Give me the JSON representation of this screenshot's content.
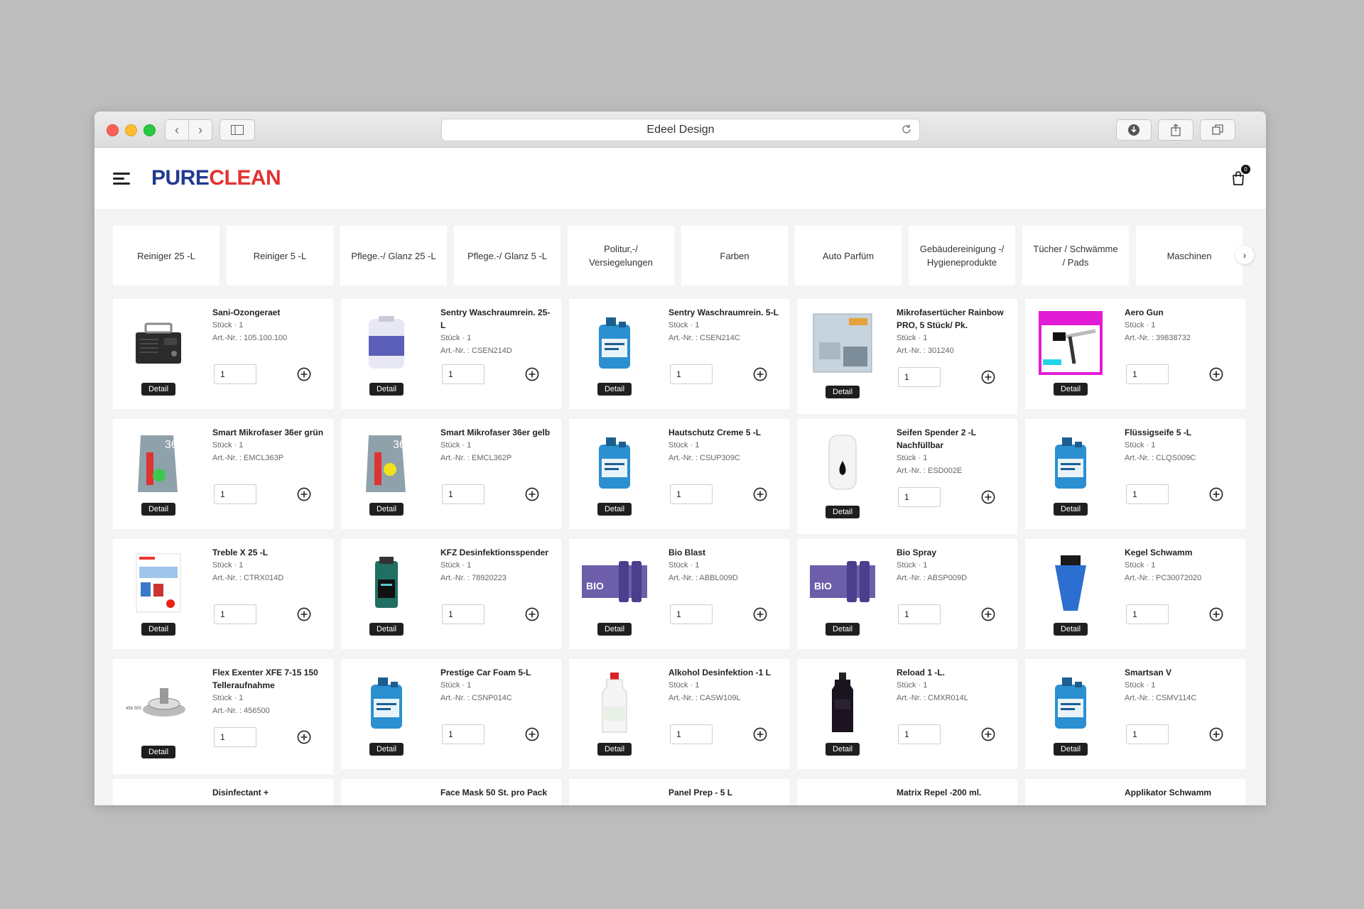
{
  "browser": {
    "url_title": "Edeel Design"
  },
  "brand": {
    "part1": "PURE",
    "part2": "CLEAN",
    "cart_count": "0"
  },
  "categories": [
    "Reiniger 25 -L",
    "Reiniger 5 -L",
    "Pflege.-/ Glanz 25 -L",
    "Pflege.-/ Glanz 5 -L",
    "Politur,-/ Versiegelungen",
    "Farben",
    "Auto Parfüm",
    "Gebäudereinigung -/ Hygieneprodukte",
    "Tücher / Schwämme / Pads",
    "Maschinen"
  ],
  "detail_label": "Detail",
  "products": [
    {
      "name": "Sani-Ozongeraet",
      "qty_text": "Stück · 1",
      "art": "Art.-Nr. : 105.100.100",
      "qty": "1",
      "icon": "ozone-generator"
    },
    {
      "name": "Sentry Waschraumrein. 25-L",
      "qty_text": "Stück · 1",
      "art": "Art.-Nr. : CSEN214D",
      "qty": "1",
      "icon": "drum"
    },
    {
      "name": "Sentry Waschraumrein. 5-L",
      "qty_text": "Stück · 1",
      "art": "Art.-Nr. : CSEN214C",
      "qty": "1",
      "icon": "canister"
    },
    {
      "name": "Mikrofasertücher Rainbow PRO, 5 Stück/ Pk.",
      "qty_text": "Stück · 1",
      "art": "Art.-Nr. : 301240",
      "qty": "1",
      "icon": "cloth-pack"
    },
    {
      "name": "Aero Gun",
      "qty_text": "Stück · 1",
      "art": "Art.-Nr. : 39838732",
      "qty": "1",
      "icon": "air-gun"
    },
    {
      "name": "Smart Mikrofaser 36er grün",
      "qty_text": "Stück · 1",
      "art": "Art.-Nr. : EMCL363P",
      "qty": "1",
      "icon": "bag-green"
    },
    {
      "name": "Smart Mikrofaser 36er gelb",
      "qty_text": "Stück · 1",
      "art": "Art.-Nr. : EMCL362P",
      "qty": "1",
      "icon": "bag-yellow"
    },
    {
      "name": "Hautschutz Creme 5 -L",
      "qty_text": "Stück · 1",
      "art": "Art.-Nr. : CSUP309C",
      "qty": "1",
      "icon": "canister"
    },
    {
      "name": "Seifen Spender 2 -L Nachfüllbar",
      "qty_text": "Stück · 1",
      "art": "Art.-Nr. : ESD002E",
      "qty": "1",
      "icon": "dispenser"
    },
    {
      "name": "Flüssigseife 5 -L",
      "qty_text": "Stück · 1",
      "art": "Art.-Nr. : CLQS009C",
      "qty": "1",
      "icon": "canister"
    },
    {
      "name": "Treble X 25 -L",
      "qty_text": "Stück · 1",
      "art": "Art.-Nr. : CTRX014D",
      "qty": "1",
      "icon": "flyer"
    },
    {
      "name": "KFZ Desinfektionsspender",
      "qty_text": "Stück · 1",
      "art": "Art.-Nr. : 78920223",
      "qty": "1",
      "icon": "spender-box"
    },
    {
      "name": "Bio Blast",
      "qty_text": "Stück · 1",
      "art": "Art.-Nr. : ABBL009D",
      "qty": "1",
      "icon": "spray-cans"
    },
    {
      "name": "Bio Spray",
      "qty_text": "Stück · 1",
      "art": "Art.-Nr. : ABSP009D",
      "qty": "1",
      "icon": "spray-cans"
    },
    {
      "name": "Kegel Schwamm",
      "qty_text": "Stück · 1",
      "art": "Art.-Nr. : PC30072020",
      "qty": "1",
      "icon": "cone-sponge"
    },
    {
      "name": "Flex Exenter XFE 7-15 150 Telleraufnahme",
      "qty_text": "Stück · 1",
      "art": "Art.-Nr. : 456500",
      "qty": "1",
      "icon": "backing-plate"
    },
    {
      "name": "Prestige Car Foam 5-L",
      "qty_text": "Stück · 1",
      "art": "Art.-Nr. : CSNP014C",
      "qty": "1",
      "icon": "canister"
    },
    {
      "name": "Alkohol Desinfektion -1 L",
      "qty_text": "Stück · 1",
      "art": "Art.-Nr. : CASW109L",
      "qty": "1",
      "icon": "bottle-white"
    },
    {
      "name": "Reload 1 -L.",
      "qty_text": "Stück · 1",
      "art": "Art.-Nr. : CMXR014L",
      "qty": "1",
      "icon": "bottle-black"
    },
    {
      "name": "Smartsan V",
      "qty_text": "Stück · 1",
      "art": "Art.-Nr. : CSMV114C",
      "qty": "1",
      "icon": "canister"
    }
  ],
  "partial_products": [
    "Disinfectant +",
    "Face Mask 50 St. pro Pack",
    "Panel Prep - 5 L",
    "Matrix Repel -200 ml.",
    "Applikator Schwamm"
  ],
  "colors": {
    "brand_blue": "#233a8f",
    "brand_red": "#e23232",
    "canister_blue": "#2b8fd0"
  }
}
